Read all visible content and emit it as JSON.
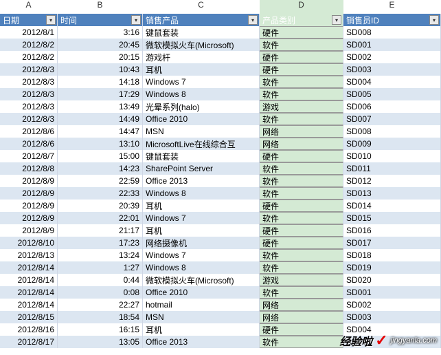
{
  "column_letters": [
    "A",
    "B",
    "C",
    "D",
    "E"
  ],
  "insert_marker": "↓",
  "headers": [
    "日期",
    "时间",
    "销售产品",
    "产品类别",
    "销售员ID"
  ],
  "rows": [
    {
      "date": "2012/8/1",
      "time": "3:16",
      "product": "键鼠套装",
      "category": "硬件",
      "salesid": "SD008"
    },
    {
      "date": "2012/8/2",
      "time": "20:45",
      "product": "微软模拟火车(Microsoft)",
      "category": "软件",
      "salesid": "SD001"
    },
    {
      "date": "2012/8/2",
      "time": "20:15",
      "product": "游戏杆",
      "category": "硬件",
      "salesid": "SD002"
    },
    {
      "date": "2012/8/3",
      "time": "10:43",
      "product": "耳机",
      "category": "硬件",
      "salesid": "SD003"
    },
    {
      "date": "2012/8/3",
      "time": "14:18",
      "product": "Windows 7",
      "category": "软件",
      "salesid": "SD004"
    },
    {
      "date": "2012/8/3",
      "time": "17:29",
      "product": "Windows 8",
      "category": "软件",
      "salesid": "SD005"
    },
    {
      "date": "2012/8/3",
      "time": "13:49",
      "product": "光晕系列(halo)",
      "category": "游戏",
      "salesid": "SD006"
    },
    {
      "date": "2012/8/3",
      "time": "14:49",
      "product": "Office 2010",
      "category": "软件",
      "salesid": "SD007"
    },
    {
      "date": "2012/8/6",
      "time": "14:47",
      "product": "MSN",
      "category": "网络",
      "salesid": "SD008"
    },
    {
      "date": "2012/8/6",
      "time": "13:10",
      "product": "MicrosoftLive在线综合互",
      "category": "网络",
      "salesid": "SD009"
    },
    {
      "date": "2012/8/7",
      "time": "15:00",
      "product": "键鼠套装",
      "category": "硬件",
      "salesid": "SD010"
    },
    {
      "date": "2012/8/8",
      "time": "14:23",
      "product": "SharePoint Server",
      "category": "软件",
      "salesid": "SD011"
    },
    {
      "date": "2012/8/9",
      "time": "22:59",
      "product": "Office 2013",
      "category": "软件",
      "salesid": "SD012"
    },
    {
      "date": "2012/8/9",
      "time": "22:33",
      "product": "Windows 8",
      "category": "软件",
      "salesid": "SD013"
    },
    {
      "date": "2012/8/9",
      "time": "20:39",
      "product": "耳机",
      "category": "硬件",
      "salesid": "SD014"
    },
    {
      "date": "2012/8/9",
      "time": "22:01",
      "product": "Windows 7",
      "category": "软件",
      "salesid": "SD015"
    },
    {
      "date": "2012/8/9",
      "time": "21:17",
      "product": "耳机",
      "category": "硬件",
      "salesid": "SD016"
    },
    {
      "date": "2012/8/10",
      "time": "17:23",
      "product": "网络摄像机",
      "category": "硬件",
      "salesid": "SD017"
    },
    {
      "date": "2012/8/13",
      "time": "13:24",
      "product": "Windows 7",
      "category": "软件",
      "salesid": "SD018"
    },
    {
      "date": "2012/8/14",
      "time": "1:27",
      "product": "Windows 8",
      "category": "软件",
      "salesid": "SD019"
    },
    {
      "date": "2012/8/14",
      "time": "0:44",
      "product": "微软模拟火车(Microsoft)",
      "category": "游戏",
      "salesid": "SD020"
    },
    {
      "date": "2012/8/14",
      "time": "0:08",
      "product": "Office 2010",
      "category": "软件",
      "salesid": "SD001"
    },
    {
      "date": "2012/8/14",
      "time": "22:27",
      "product": "hotmail",
      "category": "网络",
      "salesid": "SD002"
    },
    {
      "date": "2012/8/15",
      "time": "18:54",
      "product": "MSN",
      "category": "网络",
      "salesid": "SD003"
    },
    {
      "date": "2012/8/16",
      "time": "16:15",
      "product": "耳机",
      "category": "硬件",
      "salesid": "SD004"
    },
    {
      "date": "2012/8/17",
      "time": "13:05",
      "product": "Office 2013",
      "category": "软件",
      "salesid": "SD005"
    }
  ],
  "watermark": {
    "text": "经验啦",
    "url": "jingyanla.com"
  }
}
